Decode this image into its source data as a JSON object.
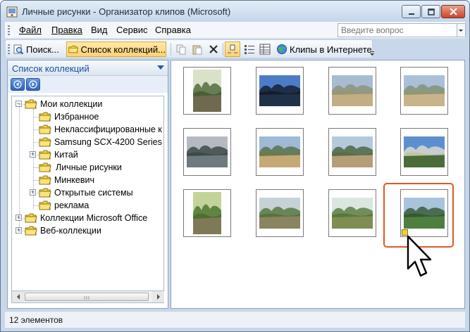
{
  "window": {
    "title": "Личные рисунки - Организатор клипов (Microsoft)"
  },
  "menu": {
    "items": [
      {
        "label": "Файл",
        "underline": "Ф"
      },
      {
        "label": "Правка",
        "underline": "П"
      },
      {
        "label": "Вид",
        "underline": "В"
      },
      {
        "label": "Сервис",
        "underline": "С"
      },
      {
        "label": "Справка",
        "underline": "С"
      }
    ],
    "search_placeholder": "Введите вопрос"
  },
  "toolbar": {
    "search_label": "Поиск...",
    "collections_label": "Список коллекций...",
    "web_clips_label": "Клипы в Интернете"
  },
  "collections_pane": {
    "title": "Список коллекций",
    "tree": [
      {
        "label": "Мои коллекции",
        "level": 0,
        "expander": "−"
      },
      {
        "label": "Избранное",
        "level": 1,
        "expander": ""
      },
      {
        "label": "Неклассифицированные к",
        "level": 1,
        "expander": ""
      },
      {
        "label": "Samsung SCX-4200 Series",
        "level": 1,
        "expander": ""
      },
      {
        "label": "Китай",
        "level": 1,
        "expander": "+"
      },
      {
        "label": "Личные рисунки",
        "level": 1,
        "expander": "",
        "selected": true
      },
      {
        "label": "Минкевич",
        "level": 1,
        "expander": ""
      },
      {
        "label": "Открытые системы",
        "level": 1,
        "expander": "+"
      },
      {
        "label": "реклама",
        "level": 1,
        "expander": ""
      },
      {
        "label": "Коллекции Microsoft Office",
        "level": 0,
        "expander": "+"
      },
      {
        "label": "Веб-коллекции",
        "level": 0,
        "expander": "+"
      }
    ]
  },
  "clips": [
    {
      "name": "forest-path",
      "sky": "#d9e2c8",
      "ground": "#6f6a4f",
      "accent": "#3d5c2c"
    },
    {
      "name": "city-skyline",
      "sky": "#4d7cc7",
      "ground": "#203048",
      "accent": "#0d1522"
    },
    {
      "name": "sandy-beach",
      "sky": "#a7bcd1",
      "ground": "#c2ad84",
      "accent": "#8a8f6e"
    },
    {
      "name": "dunes-shore",
      "sky": "#a9c0d8",
      "ground": "#c9b489",
      "accent": "#7d8d6a"
    },
    {
      "name": "sea-sunset",
      "sky": "#b4bac0",
      "ground": "#6e7a7e",
      "accent": "#2f3a3a"
    },
    {
      "name": "dune-pine",
      "sky": "#9fb9d6",
      "ground": "#c4a876",
      "accent": "#4f6a38"
    },
    {
      "name": "dune-trees",
      "sky": "#b5c9dc",
      "ground": "#b49e78",
      "accent": "#3f5a30"
    },
    {
      "name": "monastery",
      "sky": "#5d8fce",
      "ground": "#4c6b3a",
      "accent": "#e9e3cf"
    },
    {
      "name": "green-alley",
      "sky": "#c3d49a",
      "ground": "#7f7a56",
      "accent": "#3f6a24"
    },
    {
      "name": "park-trail",
      "sky": "#c7d2d8",
      "ground": "#8a8460",
      "accent": "#4a6c2e"
    },
    {
      "name": "birch-grove",
      "sky": "#dbe6e0",
      "ground": "#7e8d52",
      "accent": "#4b7030"
    },
    {
      "name": "river-forest",
      "sky": "#a8c3dc",
      "ground": "#4f7e41",
      "accent": "#2c4e27"
    }
  ],
  "status": {
    "text": "12 элементов"
  }
}
